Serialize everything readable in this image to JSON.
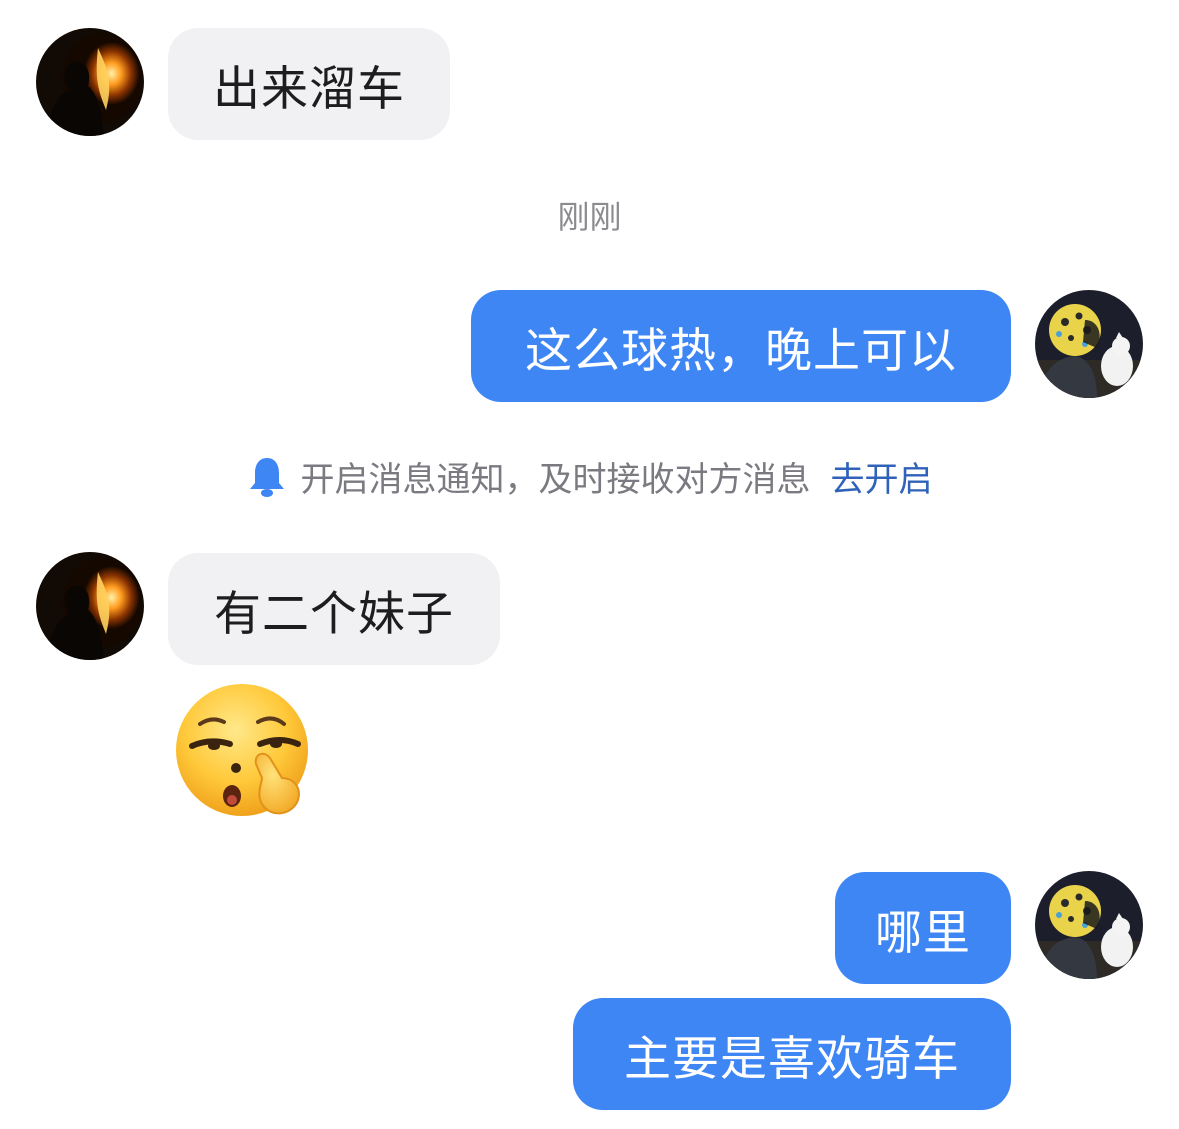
{
  "messages": {
    "m1": "出来溜车",
    "m2": "这么球热，晚上可以",
    "m3": "有二个妹子",
    "m4": "哪里",
    "m5": "主要是喜欢骑车"
  },
  "timestamp": "刚刚",
  "notification": {
    "text": "开启消息通知，及时接收对方消息",
    "action": "去开启",
    "icon": "bell-icon"
  },
  "colors": {
    "outgoing_bubble": "#3f86f5",
    "incoming_bubble": "#f1f1f4",
    "link": "#2f62b8"
  },
  "sticker": "smirking-nose-pick-emoji"
}
